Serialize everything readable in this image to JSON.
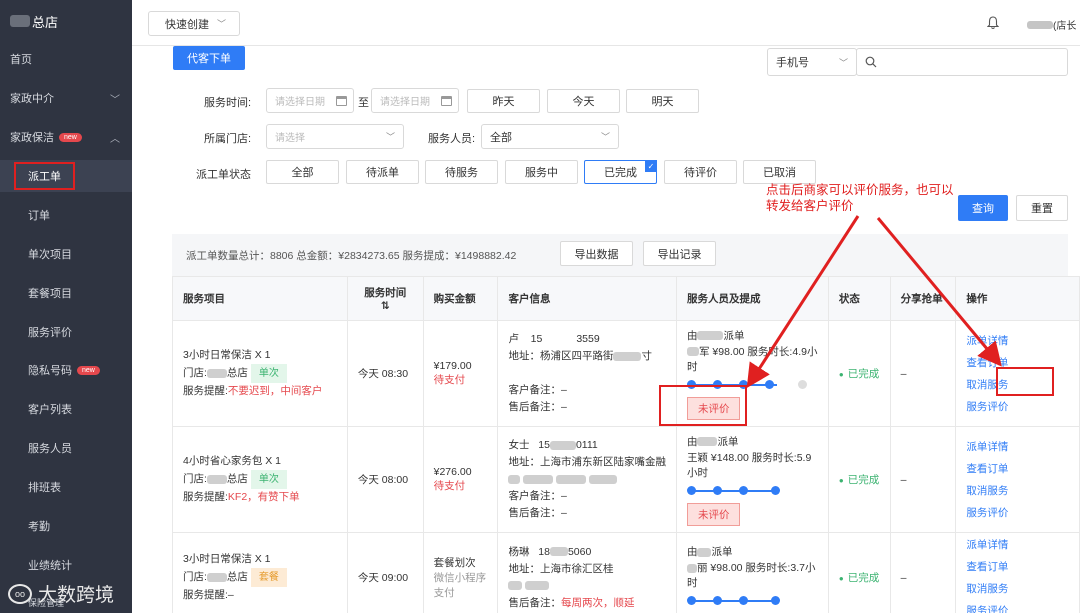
{
  "sidebar": {
    "brand": "总店",
    "items": [
      {
        "label": "首页",
        "level": 1
      },
      {
        "label": "家政中介",
        "level": 1,
        "chevron": "﹀"
      },
      {
        "label": "家政保洁",
        "level": 1,
        "badge": "new",
        "chevron": "︿"
      },
      {
        "label": "派工单",
        "level": 2,
        "active": true
      },
      {
        "label": "订单",
        "level": 2
      },
      {
        "label": "单次项目",
        "level": 2
      },
      {
        "label": "套餐项目",
        "level": 2
      },
      {
        "label": "服务评价",
        "level": 2
      },
      {
        "label": "隐私号码",
        "level": 2,
        "badge": "new"
      },
      {
        "label": "客户列表",
        "level": 2
      },
      {
        "label": "服务人员",
        "level": 2
      },
      {
        "label": "排班表",
        "level": 2
      },
      {
        "label": "考勤",
        "level": 2
      },
      {
        "label": "业绩统计",
        "level": 2
      },
      {
        "label": "保险管理",
        "level": 2
      }
    ],
    "watermark": "大数跨境"
  },
  "topbar": {
    "quick_create": "快速创建",
    "user_label": "(店长"
  },
  "toolbar": {
    "proxy_order": "代客下单",
    "search_type": "手机号",
    "search_placeholder": ""
  },
  "filters": {
    "service_time_label": "服务时间:",
    "date_start_placeholder": "请选择日期",
    "to": "至",
    "date_end_placeholder": "请选择日期",
    "yesterday": "昨天",
    "today": "今天",
    "tomorrow": "明天",
    "store_label": "所属门店:",
    "store_placeholder": "请选择",
    "staff_label": "服务人员:",
    "staff_value": "全部",
    "status_label": "派工单状态",
    "status_options": [
      "全部",
      "待派单",
      "待服务",
      "服务中",
      "已完成",
      "待评价",
      "已取消"
    ],
    "selected_status": "已完成",
    "query": "查询",
    "reset": "重置"
  },
  "summary": {
    "text": "派工单数量总计：8806    总金额：¥2834273.65    服务提成：¥1498882.42",
    "export_data": "导出数据",
    "export_log": "导出记录"
  },
  "table": {
    "headers": [
      "服务项目",
      "服务时间",
      "购买金额",
      "客户信息",
      "服务人员及提成",
      "状态",
      "分享抢单",
      "操作"
    ],
    "sort_icon": "⇅",
    "rows": [
      {
        "project": "3小时日常保洁 X 1",
        "store_prefix": "门店:",
        "store": "总店",
        "type": "单次",
        "remind_prefix": "服务提醒:",
        "remind": "不要迟到，中间客户",
        "time": "今天 08:30",
        "amount": "¥179.00",
        "pay_status": "待支付",
        "cust_name": "卢",
        "cust_phone_a": "15",
        "cust_phone_b": "3559",
        "addr": "地址：杨浦区四平路街",
        "addr_tail": "寸",
        "note": "客户备注：–",
        "after": "售后备注：–",
        "staff_pre": "由",
        "staff_post": "派单",
        "staff_line": "军 ¥98.00 服务时长:4.9小时",
        "rating": "未评价",
        "status": "已完成",
        "share": "–",
        "op1": "派单详情",
        "op2": "查看订单",
        "op3": "取消服务",
        "op4": "服务评价"
      },
      {
        "project": "4小时省心家务包 X 1",
        "store_prefix": "门店:",
        "store": "总店",
        "type": "单次",
        "remind_prefix": "服务提醒:",
        "remind": "KF2，有赞下单",
        "time": "今天 08:00",
        "amount": "¥276.00",
        "pay_status": "待支付",
        "cust_name": "女士",
        "cust_phone_a": "15",
        "cust_phone_b": "0111",
        "addr": "地址：上海市浦东新区陆家嘴金融",
        "addr_tail": "",
        "note": "客户备注：–",
        "after": "售后备注：–",
        "staff_pre": "由",
        "staff_post": "派单",
        "staff_line": "王颖 ¥148.00 服务时长:5.9小时",
        "rating": "未评价",
        "status": "已完成",
        "share": "–",
        "op1": "派单详情",
        "op2": "查看订单",
        "op3": "取消服务",
        "op4": "服务评价"
      },
      {
        "project": "3小时日常保洁 X 1",
        "store_prefix": "门店:",
        "store": "总店",
        "type": "套餐",
        "remind_prefix": "服务提醒:",
        "remind": "–",
        "time": "今天 09:00",
        "amount": "套餐划次",
        "pay_status": "微信小程序支付",
        "cust_name": "杨琳",
        "cust_phone_a": "18",
        "cust_phone_b": "5060",
        "addr": "地址：上海市徐汇区桂",
        "addr_tail": "",
        "note": "",
        "after_prefix": "售后备注：",
        "after_red": "每周两次，顺延",
        "staff_pre": "由",
        "staff_post": "派单",
        "staff_line": "丽 ¥98.00 服务时长:3.7小时",
        "rating": "",
        "status": "已完成",
        "share": "–",
        "op1": "派单详情",
        "op2": "查看订单",
        "op3": "取消服务",
        "op4": "服务评价"
      }
    ]
  },
  "annotation": "点击后商家可以评价服务，也可以转发给客户评价",
  "colors": {
    "sidebar_bg": "#2f3441",
    "primary": "#2f7cf6",
    "highlight": "#e02020",
    "success": "#3cb371"
  }
}
